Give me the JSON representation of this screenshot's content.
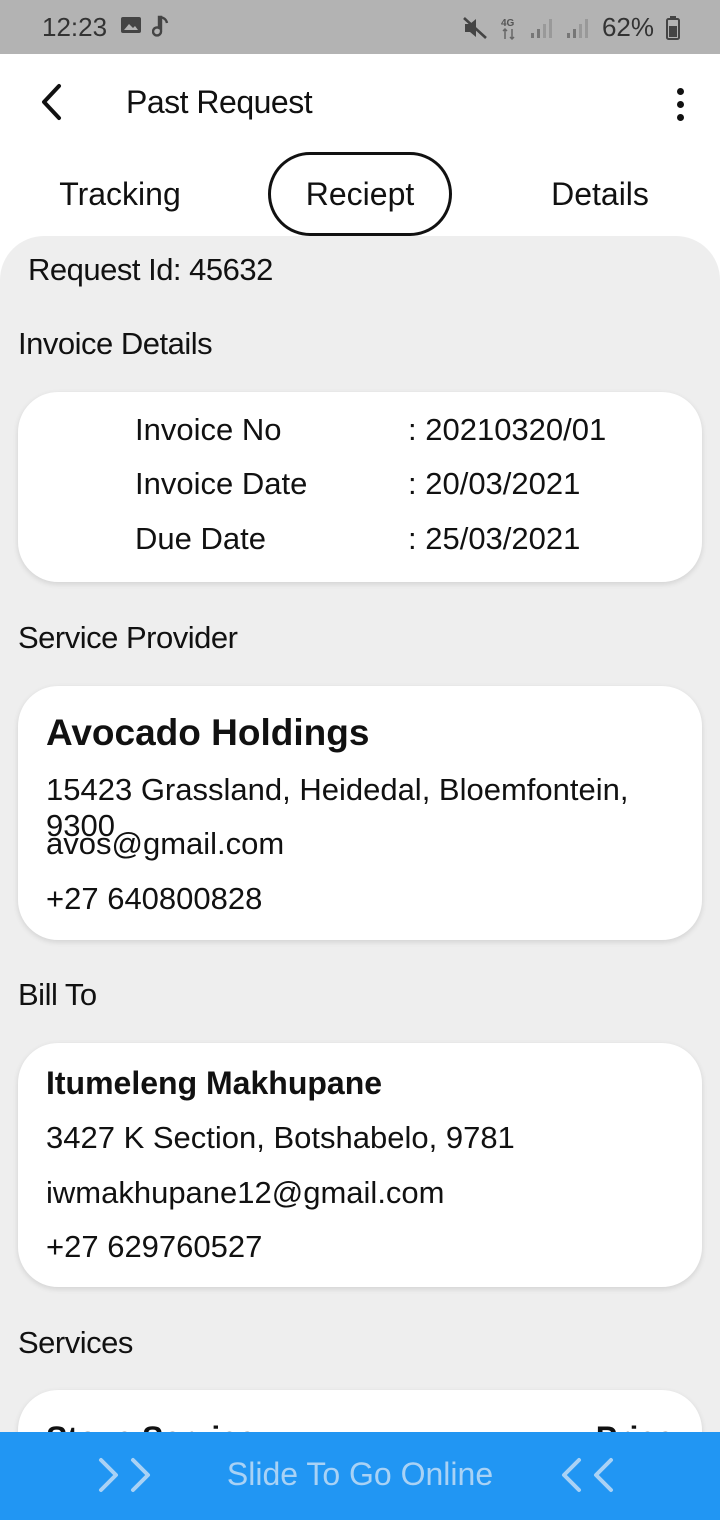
{
  "status_bar": {
    "time": "12:23",
    "battery": "62%",
    "icons": [
      "image-icon",
      "music-note-icon",
      "mute-icon",
      "4g-icon",
      "signal-icon",
      "signal-icon",
      "battery-icon"
    ]
  },
  "header": {
    "title": "Past Request"
  },
  "tabs": [
    {
      "label": "Tracking",
      "active": false
    },
    {
      "label": "Reciept",
      "active": true
    },
    {
      "label": "Details",
      "active": false
    }
  ],
  "request": {
    "id_text": "Request Id: 45632"
  },
  "invoice": {
    "section_label": "Invoice Details",
    "rows": [
      {
        "key": "Invoice No",
        "value": ": 20210320/01"
      },
      {
        "key": "Invoice Date",
        "value": ": 20/03/2021"
      },
      {
        "key": "Due Date",
        "value": ": 25/03/2021"
      }
    ]
  },
  "provider": {
    "section_label": "Service Provider",
    "name": "Avocado Holdings",
    "address": "15423 Grassland, Heidedal, Bloemfontein, 9300",
    "email": "avos@gmail.com",
    "phone": "+27 640800828"
  },
  "bill_to": {
    "section_label": "Bill To",
    "name": "Itumeleng Makhupane",
    "address": "3427 K Section, Botshabelo, 9781",
    "email": "iwmakhupane12@gmail.com",
    "phone": "+27 629760527"
  },
  "services": {
    "section_label": "Services",
    "col_service": "Stove Service",
    "col_price": "Price"
  },
  "slider": {
    "text": "Slide To Go Online"
  },
  "colors": {
    "accent": "#2196f3",
    "panel_bg": "#eeeeee",
    "status_bar": "#b3b3b3"
  }
}
